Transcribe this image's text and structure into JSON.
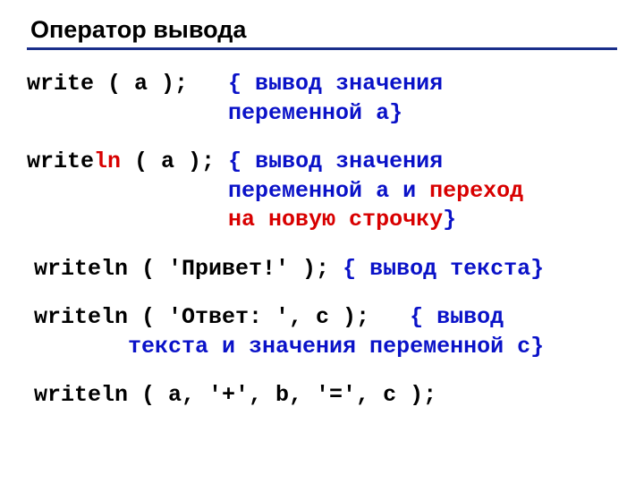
{
  "title": "Оператор вывода",
  "lines": {
    "l1a": "write ( a );   ",
    "l1b": "{ вывод значения",
    "l1c": "               переменной a}",
    "l2a": "write",
    "l2b": "ln",
    "l2c": " ( a ); ",
    "l2d": "{ вывод значения",
    "l2e": "               переменной a и ",
    "l2f": "переход",
    "l2g": "               на новую строчку",
    "l2h": "}",
    "l3a": "writeln ( 'Привет!' ); ",
    "l3b": "{ вывод текста}",
    "l4a": "writeln ( 'Ответ: ', c );   ",
    "l4b": "{ вывод",
    "l4c": "       текста и значения переменной c}",
    "l5": "writeln ( a, '+', b, '=', c );"
  }
}
